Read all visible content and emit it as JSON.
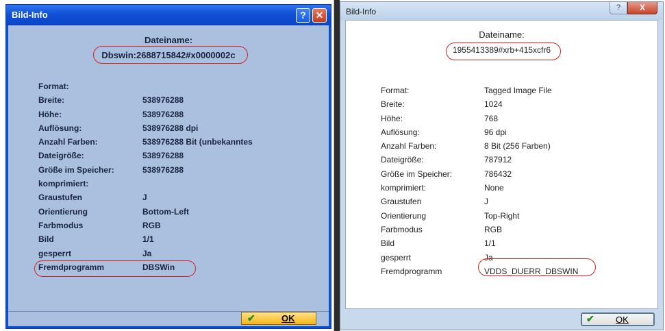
{
  "left_dialog": {
    "title": "Bild-Info",
    "help_glyph": "?",
    "close_glyph": "✕",
    "filename_label": "Dateiname:",
    "filename_value": "Dbswin:2688715842#x0000002c",
    "fields": [
      {
        "key": "Format:",
        "value": ""
      },
      {
        "key": "Breite:",
        "value": "538976288"
      },
      {
        "key": "Höhe:",
        "value": "538976288"
      },
      {
        "key": "Auflösung:",
        "value": "538976288 dpi"
      },
      {
        "key": "Anzahl Farben:",
        "value": "538976288 Bit (unbekanntes"
      },
      {
        "key": "Dateigröße:",
        "value": "538976288"
      },
      {
        "key": "Größe im Speicher:",
        "value": "538976288"
      },
      {
        "key": "komprimiert:",
        "value": ""
      },
      {
        "key": "Graustufen",
        "value": "J"
      },
      {
        "key": "Orientierung",
        "value": "Bottom-Left"
      },
      {
        "key": "Farbmodus",
        "value": "RGB"
      },
      {
        "key": "Bild",
        "value": "1/1"
      },
      {
        "key": "gesperrt",
        "value": "Ja"
      },
      {
        "key": "Fremdprogramm",
        "value": "DBSWin"
      }
    ],
    "ok_label": "OK"
  },
  "right_dialog": {
    "title": "Bild-Info",
    "help_glyph": "?",
    "close_glyph": "X",
    "filename_label": "Dateiname:",
    "filename_value": "1955413389#xrb+415xcfr6",
    "fields": [
      {
        "key": "Format:",
        "value": "Tagged Image File"
      },
      {
        "key": "Breite:",
        "value": "1024"
      },
      {
        "key": "Höhe:",
        "value": "768"
      },
      {
        "key": "Auflösung:",
        "value": "96 dpi"
      },
      {
        "key": "Anzahl Farben:",
        "value": "8 Bit (256 Farben)"
      },
      {
        "key": "Dateigröße:",
        "value": "787912"
      },
      {
        "key": "Größe im Speicher:",
        "value": "786432"
      },
      {
        "key": "komprimiert:",
        "value": "None"
      },
      {
        "key": "Graustufen",
        "value": "J"
      },
      {
        "key": "Orientierung",
        "value": "Top-Right"
      },
      {
        "key": "Farbmodus",
        "value": "RGB"
      },
      {
        "key": "Bild",
        "value": "1/1"
      },
      {
        "key": "gesperrt",
        "value": "Ja"
      },
      {
        "key": "Fremdprogramm",
        "value": "VDDS_DUERR_DBSWIN"
      }
    ],
    "ok_label": "OK"
  },
  "colors": {
    "annotation": "#d62020",
    "xp_titlebar": "#1150d6",
    "xp_body": "#aac0de",
    "ok_check": "#1e8a1e"
  }
}
